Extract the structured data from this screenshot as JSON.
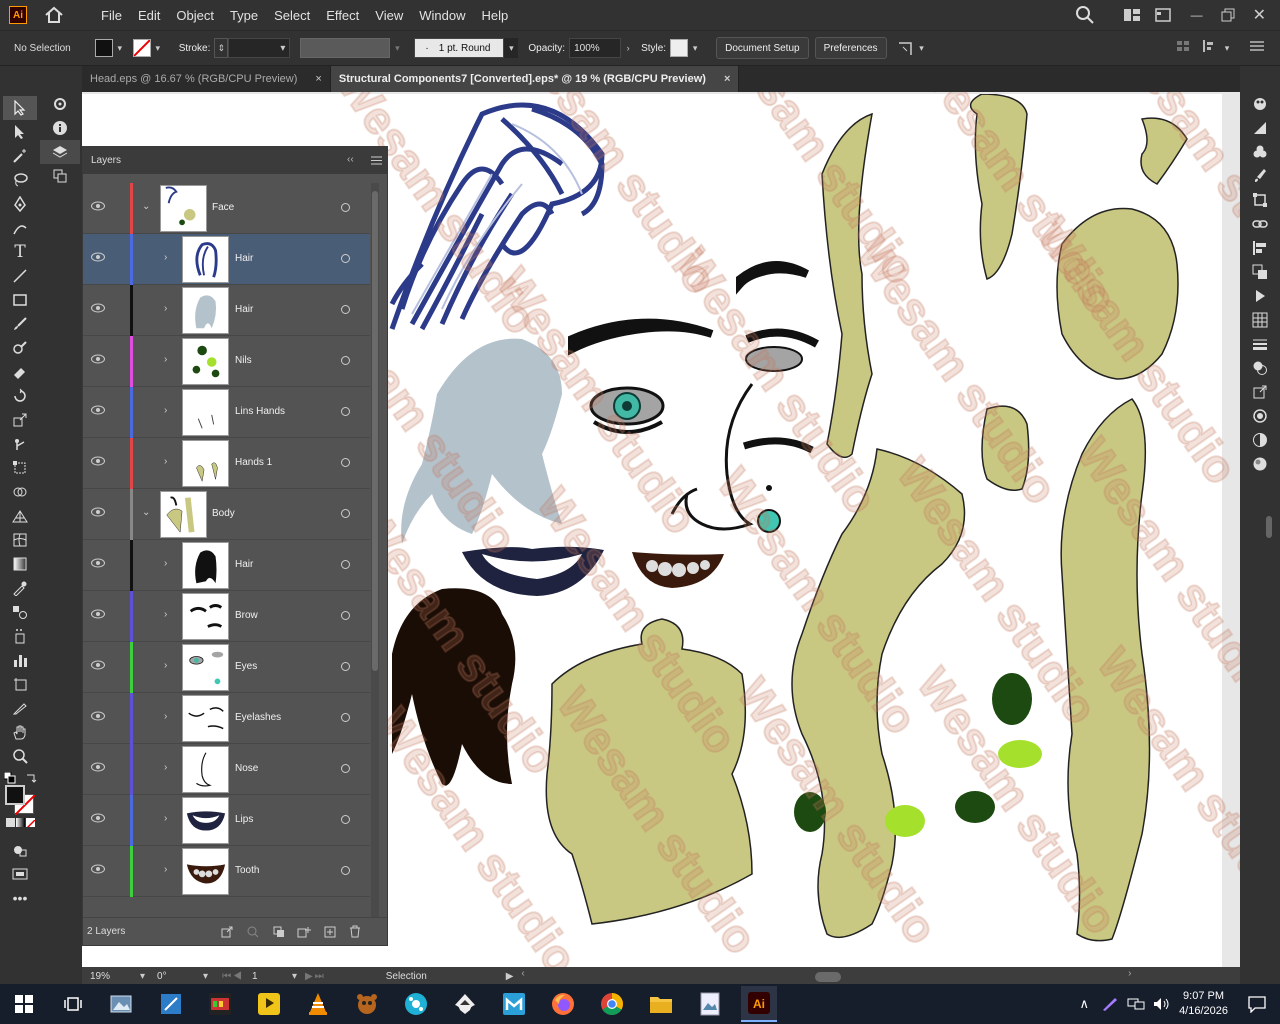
{
  "app": {
    "logo": "Ai"
  },
  "menu": [
    "File",
    "Edit",
    "Object",
    "Type",
    "Select",
    "Effect",
    "View",
    "Window",
    "Help"
  ],
  "control": {
    "selection": "No Selection",
    "stroke_label": "Stroke:",
    "brush": "1 pt. Round",
    "opacity_label": "Opacity:",
    "opacity": "100%",
    "style_label": "Style:",
    "doc_setup": "Document Setup",
    "preferences": "Preferences"
  },
  "tabs": [
    {
      "label": "Head.eps @ 16.67 % (RGB/CPU Preview)",
      "close": "×"
    },
    {
      "label": "Structural Components7 [Converted].eps* @ 19 % (RGB/CPU Preview)",
      "close": "×"
    }
  ],
  "layers_panel": {
    "title": "Layers",
    "footer": "2 Layers",
    "rows": [
      {
        "name": "Face",
        "color": "#e04646",
        "expanded": true,
        "level": 0
      },
      {
        "name": "Hair",
        "color": "#4b6ae0",
        "expanded": false,
        "level": 1
      },
      {
        "name": "Hair",
        "color": "#111111",
        "expanded": false,
        "level": 1
      },
      {
        "name": "Nils",
        "color": "#e04ee0",
        "expanded": false,
        "level": 1
      },
      {
        "name": "Lins Hands",
        "color": "#4b6ae0",
        "expanded": false,
        "level": 1
      },
      {
        "name": "Hands 1",
        "color": "#e04646",
        "expanded": false,
        "level": 1
      },
      {
        "name": "Body",
        "color": "#888888",
        "expanded": true,
        "level": 0
      },
      {
        "name": "Hair",
        "color": "#111111",
        "expanded": false,
        "level": 1
      },
      {
        "name": "Brow",
        "color": "#5f50d8",
        "expanded": false,
        "level": 1
      },
      {
        "name": "Eyes",
        "color": "#3cd03c",
        "expanded": false,
        "level": 1
      },
      {
        "name": "Eyelashes",
        "color": "#5f50d8",
        "expanded": false,
        "level": 1
      },
      {
        "name": "Nose",
        "color": "#5f50d8",
        "expanded": false,
        "level": 1
      },
      {
        "name": "Lips",
        "color": "#4b6ae0",
        "expanded": false,
        "level": 1
      },
      {
        "name": "Tooth",
        "color": "#3cd03c",
        "expanded": false,
        "level": 1
      }
    ]
  },
  "status": {
    "zoom": "19%",
    "rotation": "0°",
    "artboard": "1",
    "tool": "Selection"
  },
  "taskbar": {
    "time": "9:07 PM",
    "date": "4/16/2026"
  },
  "watermark": "Wesam studio"
}
